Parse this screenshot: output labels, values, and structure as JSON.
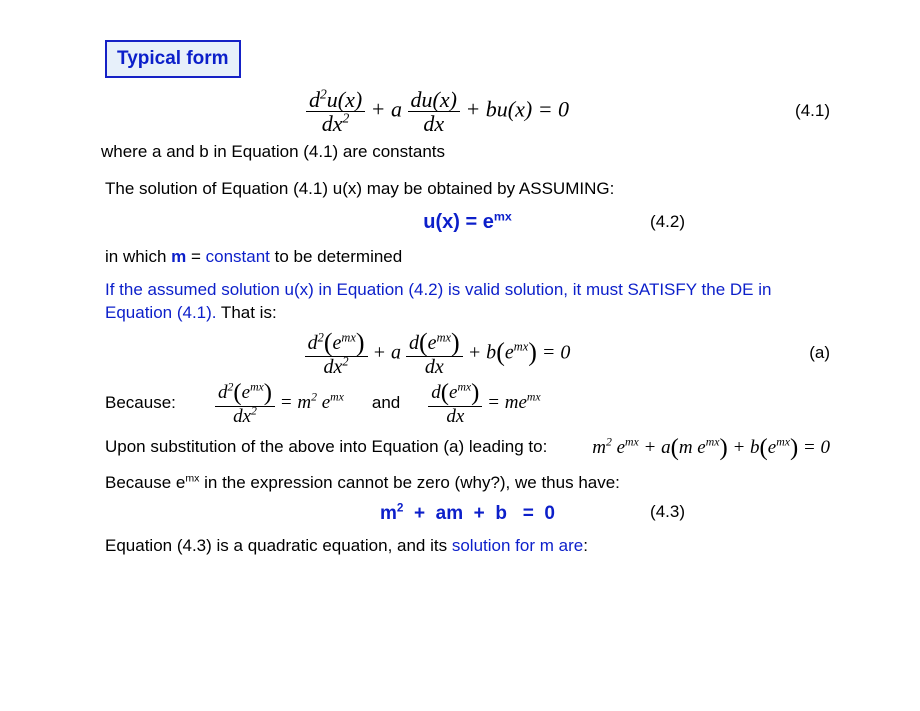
{
  "title": "Typical form",
  "eq41": {
    "html": "<span class='frac'><span class='top'>d<sup>2</sup>u(x)</span><span class='bot'>dx<sup>2</sup></span></span> + a <span class='frac'><span class='top'>du(x)</span><span class='bot'>dx</span></span> + bu(x) = 0",
    "num": "(4.1)"
  },
  "line_where": "where a and b in Equation (4.1) are constants",
  "line_solution": "The solution of Equation (4.1) u(x) may be obtained by ASSUMING:",
  "eq42": {
    "text": "u(x) = e",
    "sup": "mx",
    "num": "(4.2)"
  },
  "line_m": {
    "pre": "in which ",
    "m": "m",
    "post1": " = ",
    "const": "constant",
    "post2": " to be determined"
  },
  "line_valid": {
    "blue": "If the assumed solution u(x) in Equation (4.2) is valid solution, it must SATISFY the DE in Equation (4.1).",
    "black": " That is:"
  },
  "eqa": {
    "html": "<span class='frac'><span class='top'>d<sup>2</sup><span class='big-paren'>(</span>e<sup>mx</sup><span class='big-paren'>)</span></span><span class='bot'>dx<sup>2</sup></span></span> + a <span class='frac'><span class='top'>d<span class='big-paren'>(</span>e<sup>mx</sup><span class='big-paren'>)</span></span><span class='bot'>dx</span></span> + b<span class='big-paren'>(</span>e<sup>mx</sup><span class='big-paren'>)</span> = 0",
    "num": "(a)"
  },
  "because": "Because:",
  "deriv1": "<span class='frac'><span class='top'>d<sup>2</sup><span class='big-paren'>(</span>e<sup>mx</sup><span class='big-paren'>)</span></span><span class='bot'>dx<sup>2</sup></span></span> = m<sup>2</sup> e<sup>mx</sup>",
  "and": "and",
  "deriv2": "<span class='frac'><span class='top'>d<span class='big-paren'>(</span>e<sup>mx</sup><span class='big-paren'>)</span></span><span class='bot'>dx</span></span> = me<sup>mx</sup>",
  "upon": "Upon substitution of the above into Equation (a) leading to:",
  "upon_eq": "m<sup>2</sup> e<sup>mx</sup> + a<span class='big-paren'>(</span>m e<sup>mx</sup><span class='big-paren'>)</span> + b<span class='big-paren'>(</span>e<sup>mx</sup><span class='big-paren'>)</span> = 0",
  "because2": {
    "pre": "Because e",
    "sup": "mx",
    "post": " in the expression cannot be zero (why?), we thus have:"
  },
  "eq43": {
    "text": "m²  +  am  +  b   =  0",
    "num": "(4.3)"
  },
  "final": {
    "pre": "Equation (4.3) is a quadratic equation, and its ",
    "blue": "solution for m are",
    "post": ":"
  }
}
